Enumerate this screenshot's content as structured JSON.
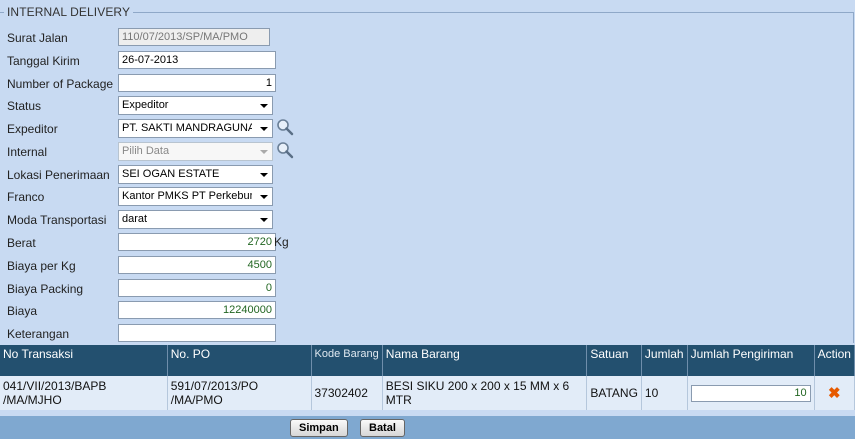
{
  "form": {
    "legend": "INTERNAL DELIVERY",
    "fields": {
      "surat_jalan": {
        "label": "Surat Jalan",
        "value": "110/07/2013/SP/MA/PMO"
      },
      "tanggal_kirim": {
        "label": "Tanggal Kirim",
        "value": "26-07-2013"
      },
      "number_of_package": {
        "label": "Number of Package",
        "value": "1"
      },
      "status": {
        "label": "Status",
        "value": "Expeditor"
      },
      "expeditor": {
        "label": "Expeditor",
        "value": "PT. SAKTI MANDRAGUNA"
      },
      "internal": {
        "label": "Internal",
        "value": "Pilih Data"
      },
      "lokasi_penerimaan": {
        "label": "Lokasi Penerimaan",
        "value": "SEI OGAN ESTATE"
      },
      "franco": {
        "label": "Franco",
        "value": "Kantor PMKS PT Perkebunan"
      },
      "moda_transportasi": {
        "label": "Moda Transportasi",
        "value": "darat"
      },
      "berat": {
        "label": "Berat",
        "value": "2720",
        "unit": "Kg"
      },
      "biaya_per_kg": {
        "label": "Biaya per Kg",
        "value": "4500"
      },
      "biaya_packing": {
        "label": "Biaya Packing",
        "value": "0"
      },
      "biaya": {
        "label": "Biaya",
        "value": "12240000"
      },
      "keterangan": {
        "label": "Keterangan",
        "value": ""
      }
    }
  },
  "table": {
    "headers": [
      "No Transaksi",
      "No. PO",
      "Kode Barang",
      "Nama Barang",
      "Satuan",
      "Jumlah",
      "Jumlah Pengiriman",
      "Action"
    ],
    "rows": [
      {
        "no_transaksi": "041/VII/2013/BAPB /MA/MJHO",
        "no_po": "591/07/2013/PO /MA/PMO",
        "kode_barang": "37302402",
        "nama_barang": "BESI SIKU 200 x 200 x 15 MM x 6 MTR",
        "satuan": "BATANG",
        "jumlah": "10",
        "jumlah_pengiriman": "10",
        "action_icon": "delete-x-icon"
      }
    ]
  },
  "buttons": {
    "simpan": "Simpan",
    "batal": "Batal"
  },
  "colors": {
    "header_bg": "#23506f",
    "page_bg": "#c8daf2",
    "footer_bg": "#7fa8d0",
    "delete": "#e65a00"
  }
}
